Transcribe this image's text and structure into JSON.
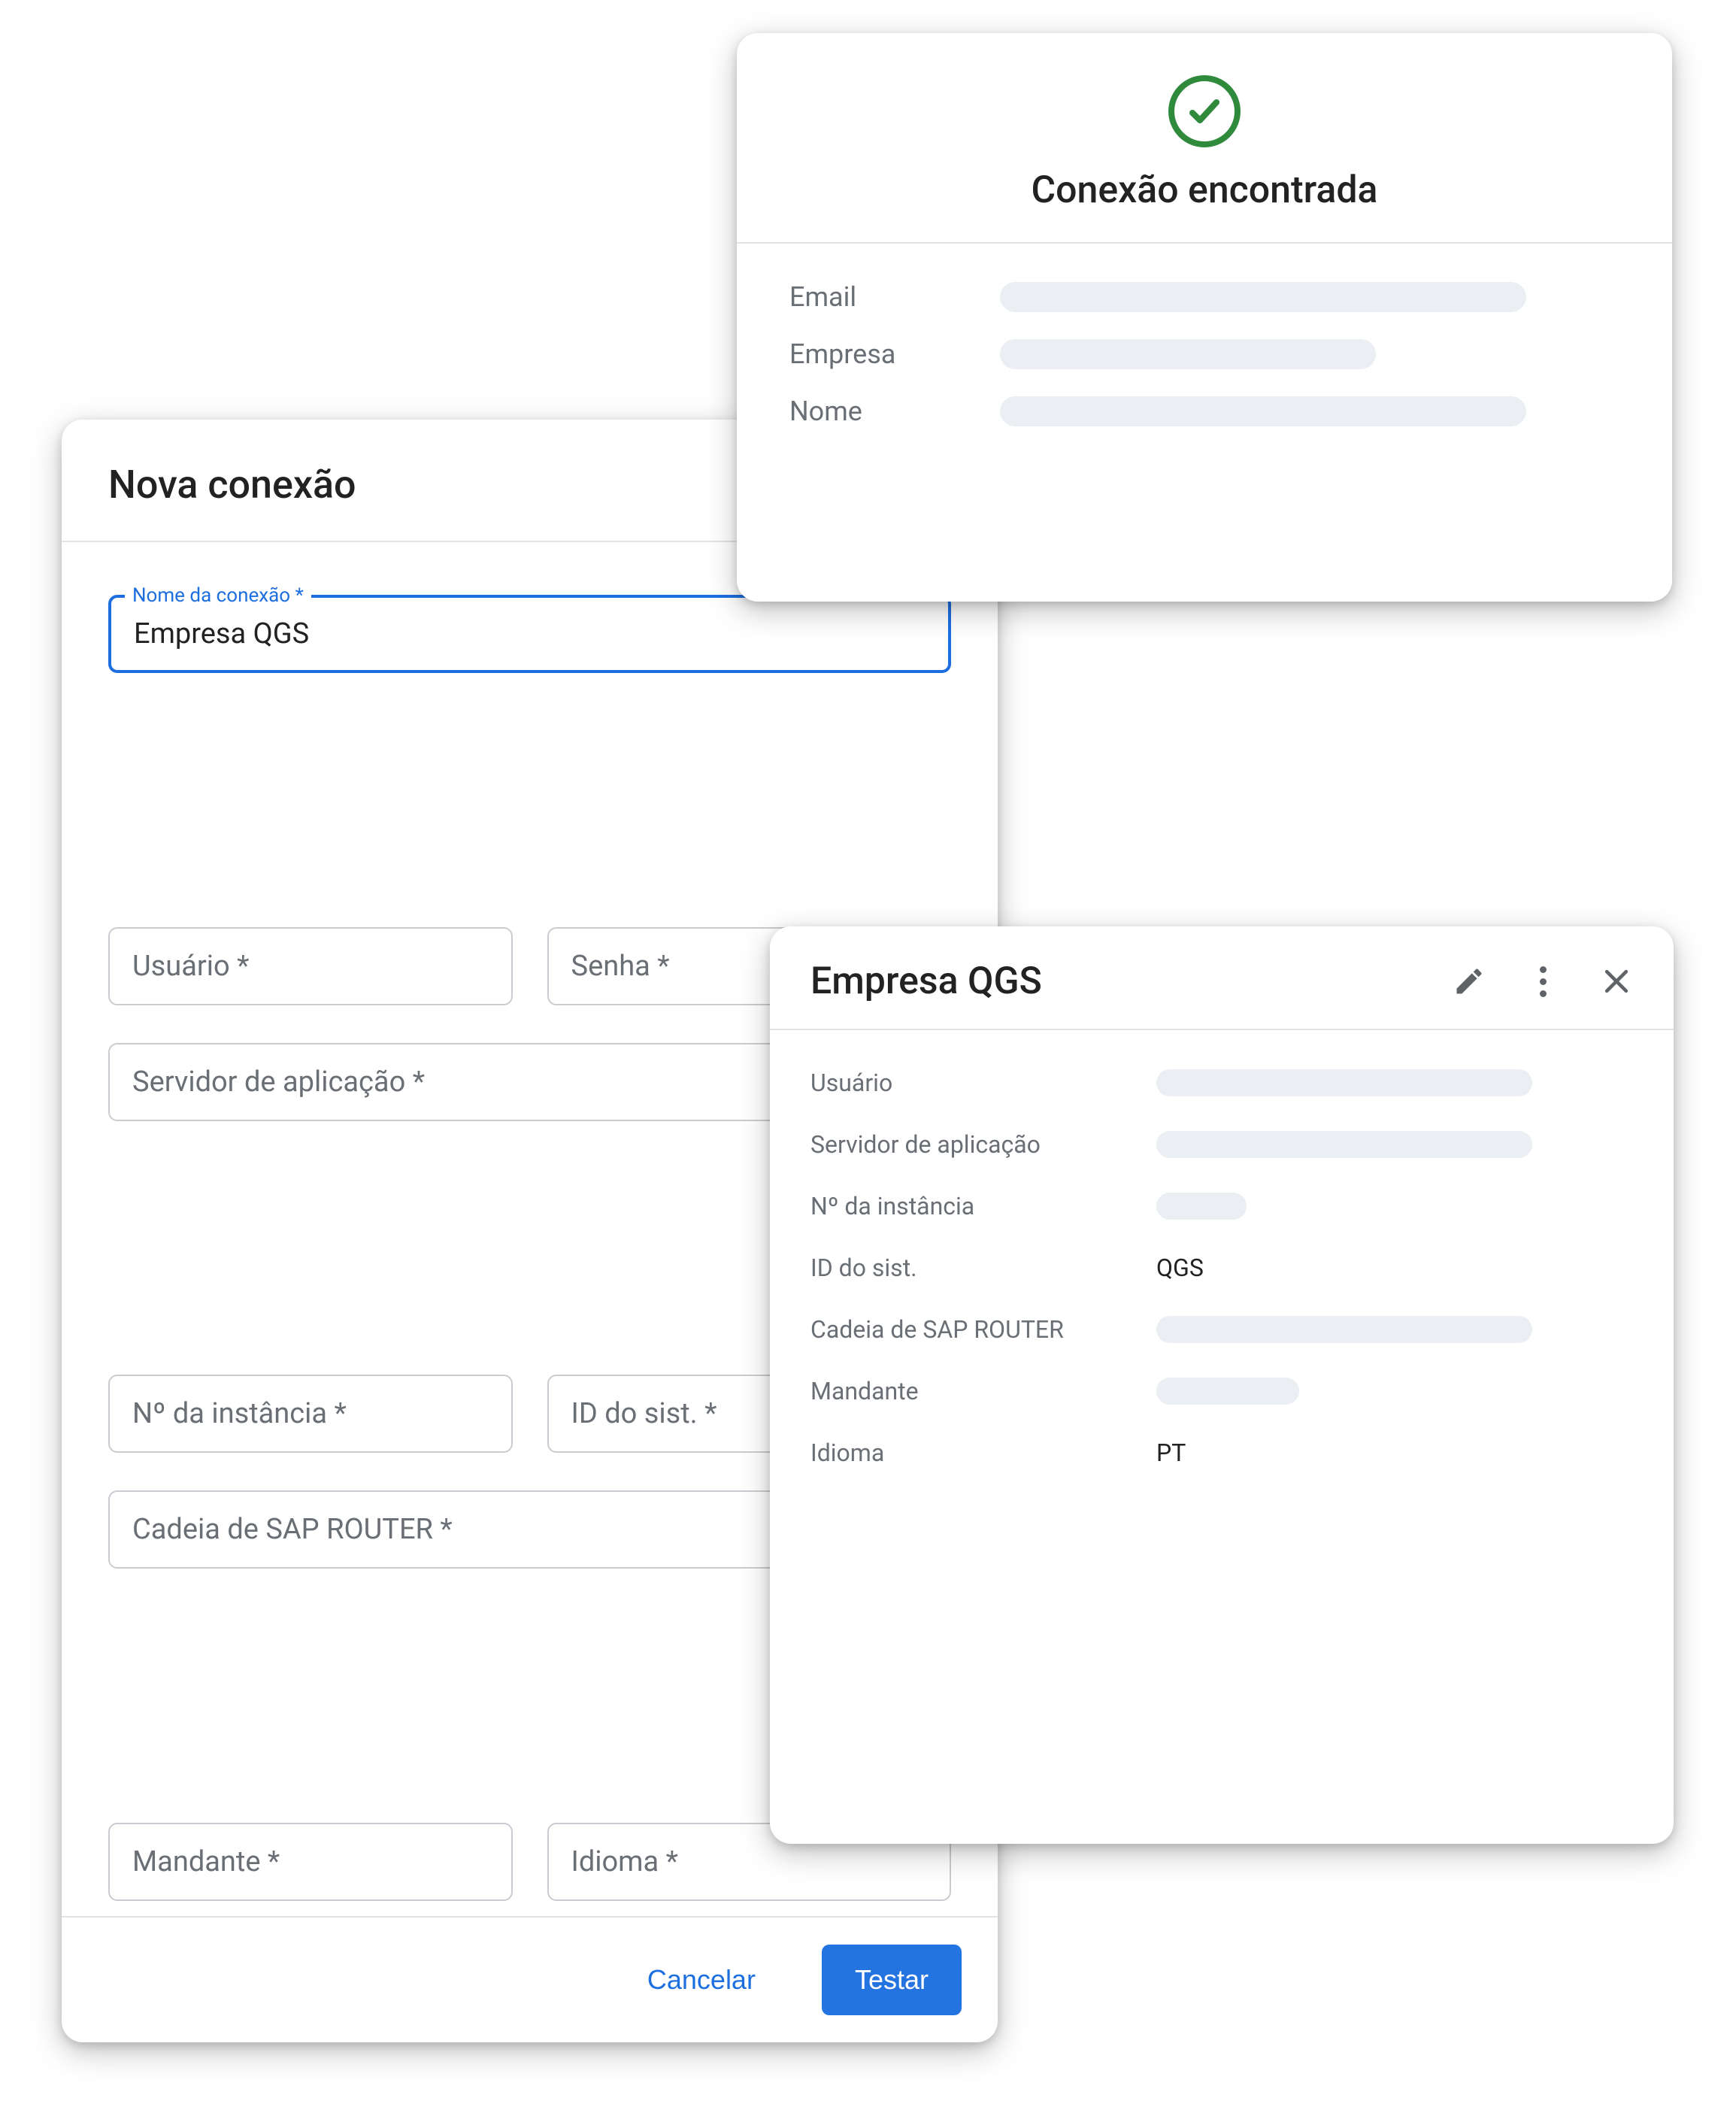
{
  "form": {
    "title": "Nova conexão",
    "fields": {
      "connection_name": {
        "label": "Nome da conexão *",
        "value": "Empresa QGS"
      },
      "user": {
        "placeholder": "Usuário *"
      },
      "password": {
        "placeholder": "Senha *"
      },
      "app_server": {
        "placeholder": "Servidor de aplicação *"
      },
      "instance_no": {
        "placeholder": "Nº da instância *"
      },
      "system_id": {
        "placeholder": "ID do sist. *"
      },
      "sap_router": {
        "placeholder": "Cadeia de SAP ROUTER *"
      },
      "client": {
        "placeholder": "Mandante *"
      },
      "language": {
        "placeholder": "Idioma *"
      }
    },
    "buttons": {
      "cancel": "Cancelar",
      "test": "Testar"
    }
  },
  "success": {
    "title": "Conexão encontrada",
    "rows": {
      "email": "Email",
      "company": "Empresa",
      "name": "Nome"
    }
  },
  "detail": {
    "title": "Empresa QGS",
    "rows": {
      "user": {
        "label": "Usuário"
      },
      "app_server": {
        "label": "Servidor de aplicação"
      },
      "instance_no": {
        "label": "Nº da instância"
      },
      "system_id": {
        "label": "ID do sist.",
        "value": "QGS"
      },
      "sap_router": {
        "label": "Cadeia de SAP ROUTER"
      },
      "client": {
        "label": "Mandante"
      },
      "language": {
        "label": "Idioma",
        "value": "PT"
      }
    }
  }
}
